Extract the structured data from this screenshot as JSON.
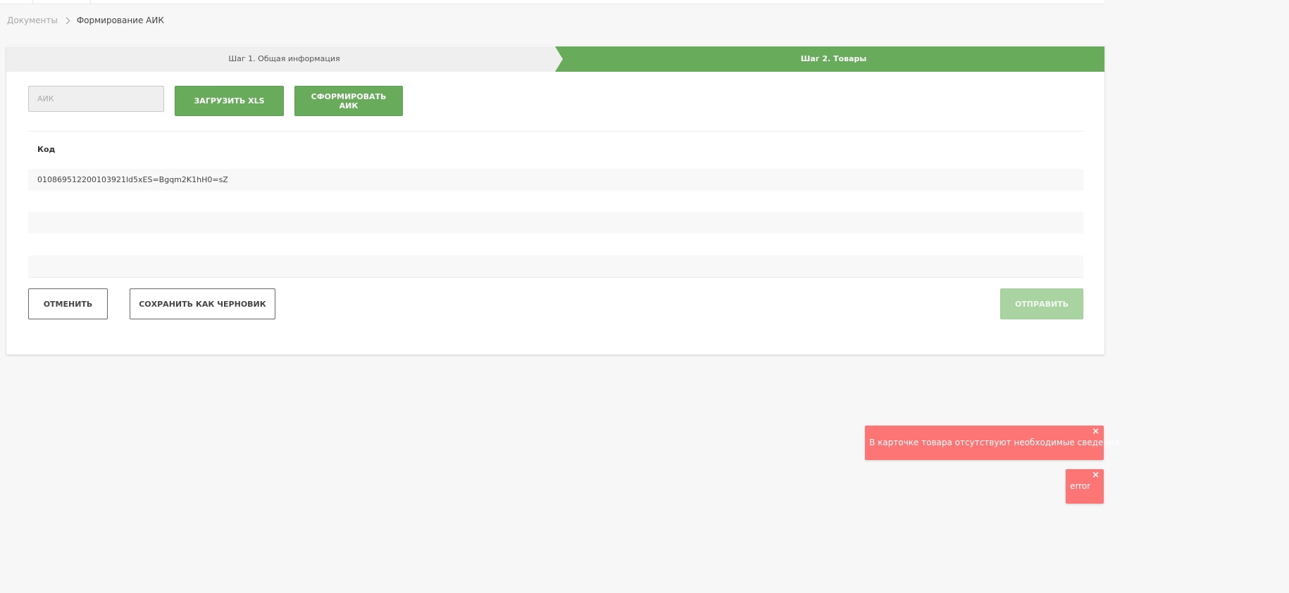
{
  "breadcrumb": {
    "parent": "Документы",
    "current": "Формирование АИК"
  },
  "steps": [
    {
      "label": "Шаг 1. Общая информация",
      "active": false
    },
    {
      "label": "Шаг 2. Товары",
      "active": true
    }
  ],
  "form": {
    "aik_placeholder": "АИК",
    "aik_value": "",
    "load_xls_label": "ЗАГРУЗИТЬ XLS",
    "form_aik_label": "СФОРМИРОВАТЬ АИК"
  },
  "table": {
    "columns": [
      "Код"
    ],
    "rows": [
      [
        "010869512200103921ld5xES=Bgqm2K1hH0=sZ"
      ],
      [
        ""
      ],
      [
        ""
      ],
      [
        ""
      ],
      [
        ""
      ]
    ]
  },
  "actions": {
    "cancel_label": "ОТМЕНИТЬ",
    "save_draft_label": "СОХРАНИТЬ КАК ЧЕРНОВИК",
    "send_label": "ОТПРАВИТЬ"
  },
  "toasts": [
    {
      "message": "В карточке товара отсутствуют необходимые сведения",
      "close": "×"
    },
    {
      "message": "error",
      "close": "×"
    }
  ],
  "colors": {
    "accent": "#67ab5b",
    "accent_disabled": "#a9d3a1",
    "toast_error": "#fe7575",
    "step_inactive": "#efefef"
  },
  "icons": {
    "breadcrumb_separator": "chevron-right-icon",
    "toast_close": "close-icon"
  }
}
